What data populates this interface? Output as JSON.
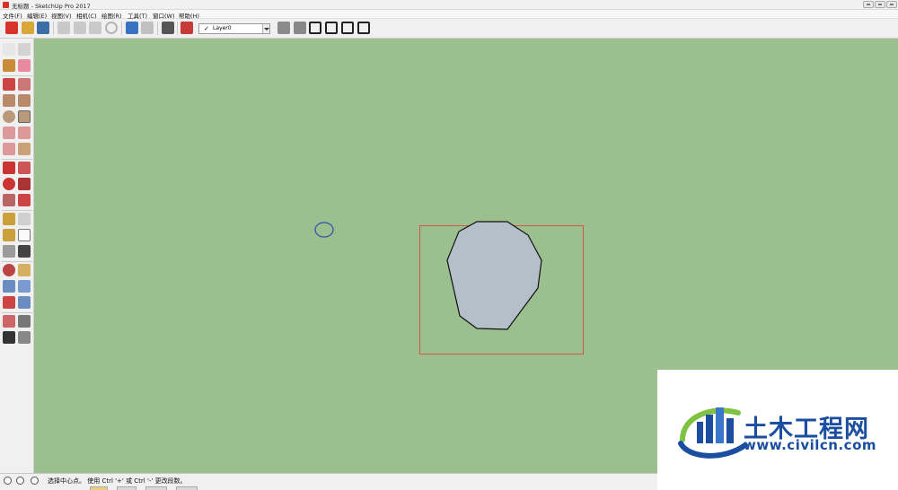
{
  "window": {
    "title": "无标题 - SketchUp Pro 2017"
  },
  "menubar": {
    "items": [
      {
        "label": "文件(F)"
      },
      {
        "label": "编辑(E)"
      },
      {
        "label": "视图(V)"
      },
      {
        "label": "相机(C)"
      },
      {
        "label": "绘图(R)"
      },
      {
        "label": "工具(T)"
      },
      {
        "label": "窗口(W)"
      },
      {
        "label": "帮助(H)"
      }
    ]
  },
  "toolbar": {
    "layer": {
      "current": "Layer0",
      "check": "✓"
    },
    "icons": [
      "new-file-icon",
      "open-folder-icon",
      "save-icon",
      "cut-icon",
      "copy-icon",
      "paste-icon",
      "erase-icon",
      "undo-icon",
      "redo-icon",
      "print-icon",
      "model-info-icon",
      "layer-manager-icon",
      "iso-view-icon",
      "top-view-icon",
      "front-view-icon",
      "right-view-icon",
      "back-view-icon",
      "left-view-icon"
    ]
  },
  "lefttoolbar": {
    "icons": [
      "select-icon",
      "make-component-icon",
      "paint-bucket-icon",
      "eraser-icon",
      "line-icon",
      "freehand-icon",
      "rectangle-icon",
      "rotated-rectangle-icon",
      "circle-icon",
      "polygon-icon",
      "arc-icon",
      "two-point-arc-icon",
      "three-point-arc-icon",
      "pie-icon",
      "move-icon",
      "push-pull-icon",
      "rotate-icon",
      "follow-me-icon",
      "scale-icon",
      "offset-icon",
      "tape-measure-icon",
      "dimension-icon",
      "protractor-icon",
      "text-icon",
      "axes-icon",
      "3d-text-icon",
      "orbit-icon",
      "pan-icon",
      "zoom-icon",
      "zoom-window-icon",
      "zoom-extents-icon",
      "previous-view-icon",
      "position-camera-icon",
      "look-around-icon",
      "walk-icon",
      "section-plane-icon"
    ]
  },
  "colors": {
    "canvas_background": "#9bbf8f",
    "polygon_fill": "#b3c0c9",
    "selection_box": "#d4574a",
    "cursor_circle": "#2b4fa8",
    "watermark_blue": "#1b4ea0",
    "watermark_green": "#7fc241"
  },
  "canvas": {
    "shape": "polygon",
    "polygon_sides": 10
  },
  "statusbar": {
    "message": "选择中心点。  使用 Ctrl '+' 或 Ctrl '-' 更改段数。"
  },
  "watermark": {
    "title": "土木工程网",
    "url": "www.civilcn.com"
  }
}
